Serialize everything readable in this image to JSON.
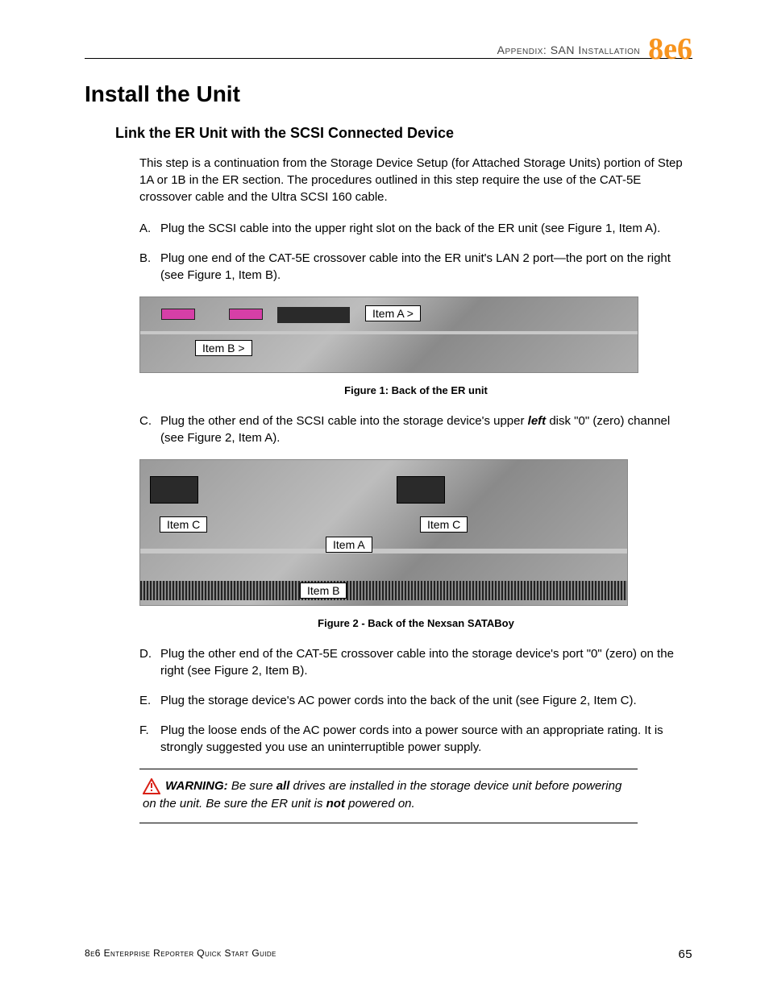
{
  "header": {
    "section": "Appendix: SAN Installation",
    "logo": "8e6"
  },
  "h1": "Install the Unit",
  "h2": "Link the ER Unit with the SCSI Connected Device",
  "intro": "This step is a continuation from the Storage Device Setup (for Attached Storage Units) portion of Step 1A or 1B in the ER section. The procedures outlined in this step require the use of the CAT-5E crossover cable and the Ultra SCSI 160 cable.",
  "steps": {
    "A": "Plug the SCSI cable into the upper right slot on the back of the ER unit (see Figure 1, Item A).",
    "B": "Plug one end of the CAT-5E crossover cable into the ER unit's LAN 2 port—the port on the right (see Figure 1, Item B).",
    "C_pre": "Plug the other end of the SCSI cable into the storage device's upper ",
    "C_emph": "left",
    "C_post": " disk \"0\" (zero) channel (see Figure 2, Item A).",
    "D": "Plug the other end of the CAT-5E crossover cable into the storage device's port \"0\" (zero) on the right (see Figure 2, Item B).",
    "E": "Plug the storage device's AC power cords into the back of the unit (see Figure 2, Item C).",
    "F": "Plug the loose ends of the AC power cords into a power source with an appropriate rating. It is strongly suggested you use an uninterruptible power supply."
  },
  "fig1": {
    "caption": "Figure 1: Back of the ER unit",
    "labels": {
      "itemA": "Item A >",
      "itemB": "Item B >"
    }
  },
  "fig2": {
    "caption": "Figure 2 - Back of the Nexsan SATABoy",
    "labels": {
      "itemA": "Item A",
      "itemB": "Item B",
      "itemC_left": "Item C",
      "itemC_right": "Item C"
    }
  },
  "warning": {
    "lead": "WARNING:",
    "t1": " Be sure ",
    "emph1": "all",
    "t2": " drives are installed in the storage device unit before powering on the unit. Be sure the ER unit is ",
    "emph2": "not",
    "t3": " powered on."
  },
  "footer": {
    "left": "8e6 Enterprise Reporter Quick Start Guide",
    "right": "65"
  }
}
